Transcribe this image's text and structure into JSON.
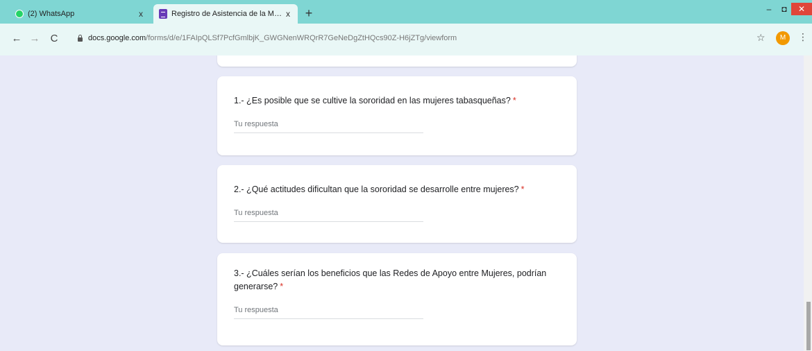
{
  "browser": {
    "tabs": [
      {
        "title": "(2) WhatsApp",
        "close": "x",
        "icon": "whatsapp-icon"
      },
      {
        "title": "Registro de Asistencia de la Mes...",
        "close": "x",
        "icon": "google-forms-icon"
      }
    ],
    "new_tab": "+",
    "window": {
      "minimize": "–",
      "maximize": "◘",
      "close": "✕"
    },
    "nav": {
      "back": "←",
      "forward": "→",
      "reload": "C"
    },
    "url": {
      "host": "docs.google.com",
      "path": "/forms/d/e/1FAIpQLSf7PcfGmlbjK_GWGNenWRQrR7GeNeDgZtHQcs90Z-H6jZTg/viewform"
    },
    "bookmark": "☆",
    "profile_initial": "M",
    "menu": "⋮"
  },
  "form": {
    "required_mark": "*",
    "answer_placeholder": "Tu respuesta",
    "questions": [
      {
        "text": "1.- ¿Es posible que se cultive la sororidad en las mujeres tabasqueñas?"
      },
      {
        "text": "2.- ¿Qué actitudes dificultan que la sororidad se desarrolle entre mujeres?"
      },
      {
        "text": "3.- ¿Cuáles serían los beneficios que las Redes de Apoyo entre Mujeres, podrían generarse?"
      }
    ]
  },
  "colors": {
    "tabstrip": "#7fd6d3",
    "toolbar": "#e9f7f6",
    "page_background": "#e8eaf8",
    "forms_accent": "#673ab7",
    "required": "#d93025",
    "profile": "#f29900"
  }
}
